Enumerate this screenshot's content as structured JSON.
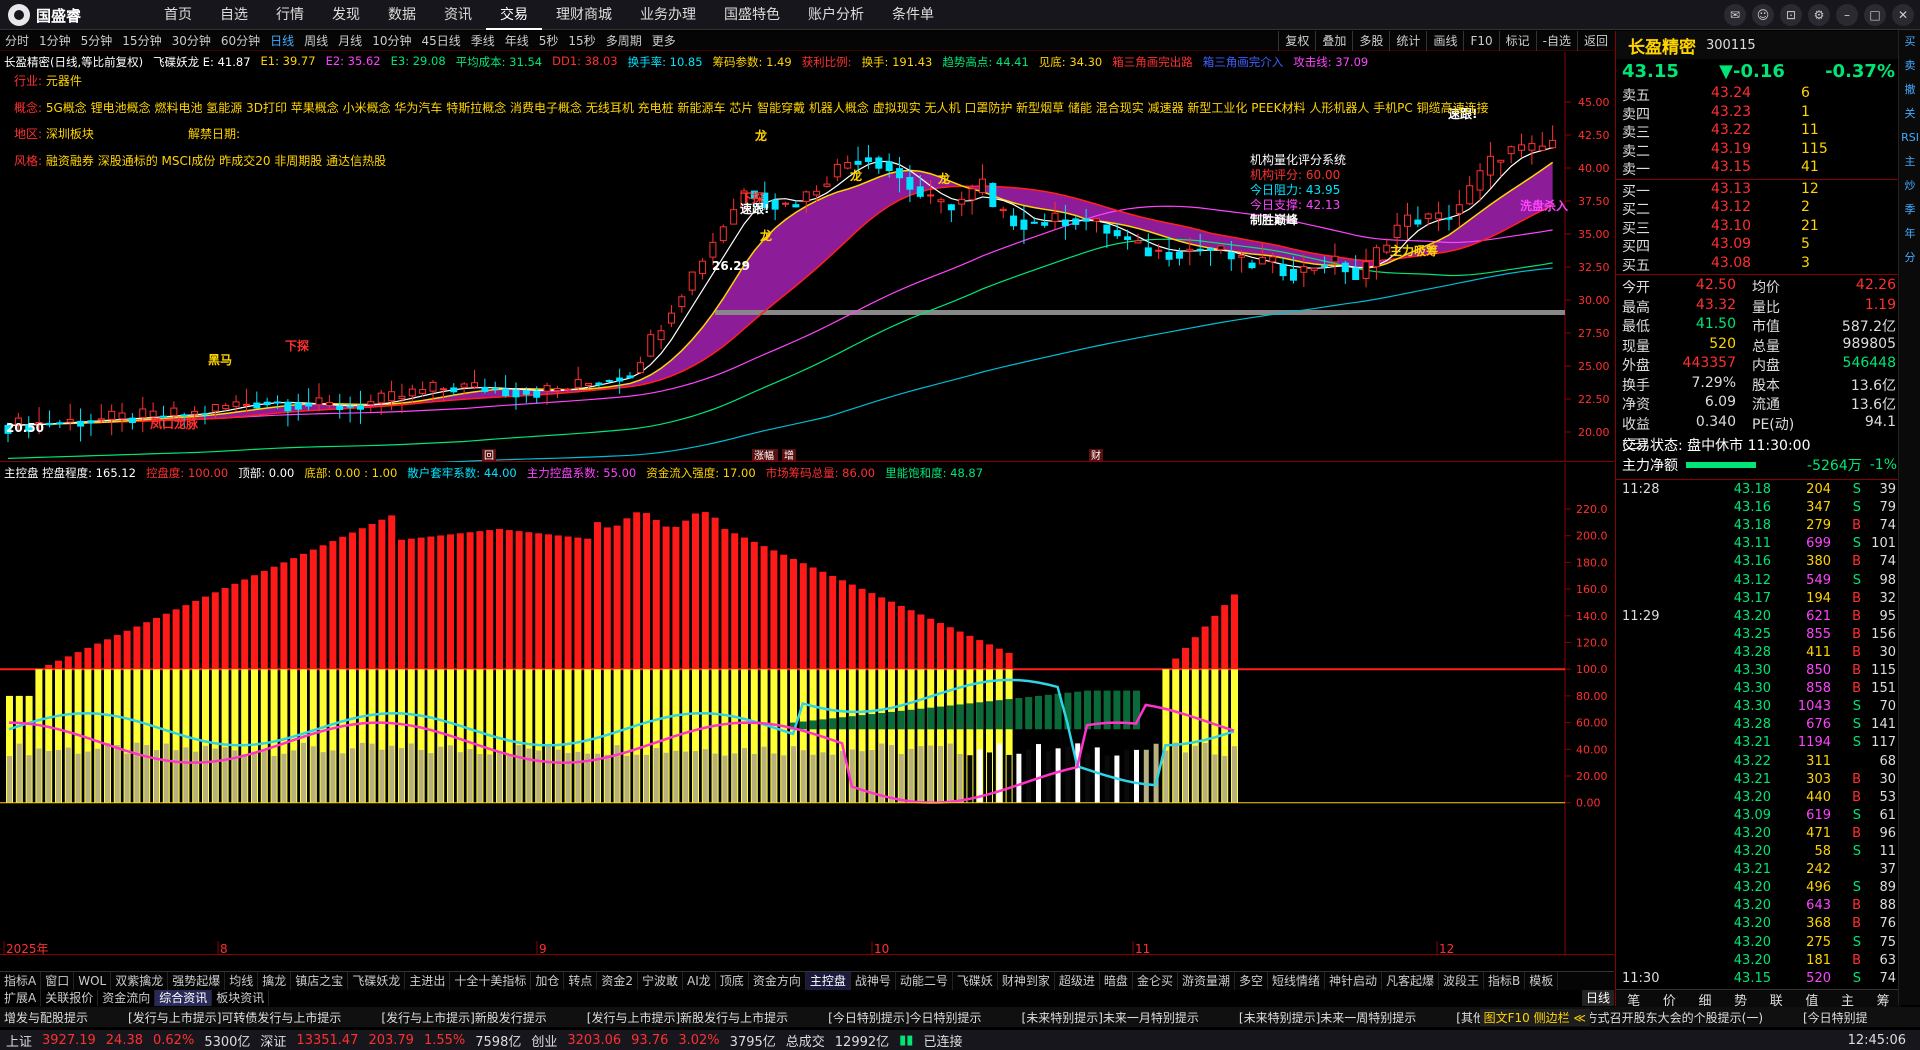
{
  "app": {
    "title": "国盛睿"
  },
  "menu": [
    "首页",
    "自选",
    "行情",
    "发现",
    "数据",
    "资讯",
    "交易",
    "理财商城",
    "业务办理",
    "国盛特色",
    "账户分析",
    "条件单"
  ],
  "menu_active": 6,
  "periods": [
    "分时",
    "1分钟",
    "5分钟",
    "15分钟",
    "30分钟",
    "60分钟",
    "日线",
    "周线",
    "月线",
    "10分钟",
    "45日线",
    "季线",
    "年线",
    "5秒",
    "15秒",
    "多周期",
    "更多"
  ],
  "period_active": 6,
  "right_tools": [
    "复权",
    "叠加",
    "多股",
    "统计",
    "画线",
    "F10",
    "标记",
    "-自选",
    "返回"
  ],
  "legend_main": [
    {
      "t": "长盈精密(日线,等比前复权)",
      "c": "#ffffff"
    },
    {
      "t": "飞碟妖龙 E: 41.87",
      "c": "#ffffff"
    },
    {
      "t": "E1: 39.77",
      "c": "#ffd400"
    },
    {
      "t": "E2: 35.62",
      "c": "#ff44ff"
    },
    {
      "t": "E3: 29.08",
      "c": "#00e676"
    },
    {
      "t": "平均成本: 31.54",
      "c": "#00e676"
    },
    {
      "t": "DD1: 38.03",
      "c": "#ff3030"
    },
    {
      "t": "换手率: 10.85",
      "c": "#00e5ff"
    },
    {
      "t": "筹码参数: 1.49",
      "c": "#ffd400"
    },
    {
      "t": "获利比例:",
      "c": "#ff3030"
    },
    {
      "t": "换手: 191.43",
      "c": "#ffd400"
    },
    {
      "t": "趋势高点: 44.41",
      "c": "#00e676"
    },
    {
      "t": "见底: 34.30",
      "c": "#ffd400"
    },
    {
      "t": "箱三角画完出路",
      "c": "#ff3030"
    },
    {
      "t": "箱三角画完介入",
      "c": "#4060ff"
    },
    {
      "t": "攻击线: 37.09",
      "c": "#ff44ff"
    }
  ],
  "info": {
    "industry_label": "行业:",
    "industry": "元器件",
    "concept_label": "概念:",
    "concepts": "5G概念 锂电池概念 燃料电池 氢能源 3D打印 苹果概念 小米概念 华为汽车 特斯拉概念 消费电子概念 无线耳机 充电桩 新能源车 芯片 智能穿戴 机器人概念 虚拟现实 无人机 口罩防护 新型烟草 储能 混合现实 减速器 新型工业化 PEEK材料 人形机器人 手机PC 铜缆高速连接",
    "region_label": "地区:",
    "region": "深圳板块",
    "lift_label": "解禁日期:",
    "style_label": "风格:",
    "style": "融资融券 深股通标的 MSCI成份 昨成交20 非周期股 通达信热股"
  },
  "score": {
    "title": "机构量化评分系统",
    "score_label": "机构评分: 60.00",
    "res_label": "今日阻力: 43.95",
    "sup_label": "今日支撑: 42.13",
    "win": "制胜巅峰"
  },
  "main_annotations": [
    "龙",
    "龙",
    "龙",
    "龙",
    "速跟!",
    "速跟!",
    "黑马",
    "下探",
    "下探",
    "主力吸筹",
    "洗盘杀入",
    "凤口龙脉",
    "26.29",
    "20.50"
  ],
  "price_axis": [
    "45.00",
    "42.50",
    "40.00",
    "37.50",
    "35.00",
    "32.50",
    "30.00",
    "27.50",
    "25.00",
    "22.50",
    "20.00"
  ],
  "sub_axis": [
    "220.0",
    "200.0",
    "180.0",
    "160.0",
    "140.0",
    "120.0",
    "100.0",
    "80.00",
    "60.00",
    "40.00",
    "20.00",
    "0.00"
  ],
  "date_axis": [
    "2025年",
    "8",
    "9",
    "10",
    "11",
    "12"
  ],
  "event_markers": [
    "回",
    "涨幅",
    "增",
    "财"
  ],
  "legend_sub": [
    {
      "t": "主控盘 控盘程度: 165.12",
      "c": "#ffffff"
    },
    {
      "t": "控盘度: 100.00",
      "c": "#ff3030"
    },
    {
      "t": "顶部: 0.00",
      "c": "#ffffff"
    },
    {
      "t": "底部: 0.00 : 1.00",
      "c": "#ffd400"
    },
    {
      "t": "散户套牢系数: 44.00",
      "c": "#00e5ff"
    },
    {
      "t": "主力控盘系数: 55.00",
      "c": "#ff44ff"
    },
    {
      "t": "资金流入强度: 17.00",
      "c": "#ffd400"
    },
    {
      "t": "市场筹码总量: 86.00",
      "c": "#ff3030"
    },
    {
      "t": "里能饱和度: 48.87",
      "c": "#00e676"
    }
  ],
  "quote": {
    "name": "长盈精密",
    "code": "300115",
    "price": "43.15",
    "change": "▼-0.16",
    "pct": "-0.37%",
    "asks": [
      {
        "l": "卖五",
        "p": "43.24",
        "v": "6"
      },
      {
        "l": "卖四",
        "p": "43.23",
        "v": "1"
      },
      {
        "l": "卖三",
        "p": "43.22",
        "v": "11"
      },
      {
        "l": "卖二",
        "p": "43.19",
        "v": "115"
      },
      {
        "l": "卖一",
        "p": "43.15",
        "v": "41"
      }
    ],
    "bids": [
      {
        "l": "买一",
        "p": "43.13",
        "v": "12"
      },
      {
        "l": "买二",
        "p": "43.12",
        "v": "2"
      },
      {
        "l": "买三",
        "p": "43.10",
        "v": "21"
      },
      {
        "l": "买四",
        "p": "43.09",
        "v": "5"
      },
      {
        "l": "买五",
        "p": "43.08",
        "v": "3"
      }
    ],
    "stats": [
      {
        "k1": "今开",
        "v1": "42.50",
        "c1": "#ff3030",
        "k2": "均价",
        "v2": "42.26",
        "c2": "#ff3030"
      },
      {
        "k1": "最高",
        "v1": "43.32",
        "c1": "#ff3030",
        "k2": "量比",
        "v2": "1.19",
        "c2": "#ff3030"
      },
      {
        "k1": "最低",
        "v1": "41.50",
        "c1": "#00e676",
        "k2": "市值",
        "v2": "587.2亿",
        "c2": "#dddddd"
      },
      {
        "k1": "现量",
        "v1": "520",
        "c1": "#ffd400",
        "k2": "总量",
        "v2": "989805",
        "c2": "#dddddd"
      },
      {
        "k1": "外盘",
        "v1": "443357",
        "c1": "#ff3030",
        "k2": "内盘",
        "v2": "546448",
        "c2": "#00e676"
      },
      {
        "k1": "换手",
        "v1": "7.29%",
        "c1": "#dddddd",
        "k2": "股本",
        "v2": "13.6亿",
        "c2": "#dddddd"
      },
      {
        "k1": "净资",
        "v1": "6.09",
        "c1": "#dddddd",
        "k2": "流通",
        "v2": "13.6亿",
        "c2": "#dddddd"
      },
      {
        "k1": "收益(三)",
        "v1": "0.340",
        "c1": "#dddddd",
        "k2": "PE(动)",
        "v2": "94.1",
        "c2": "#dddddd"
      }
    ],
    "trade_status": "交易状态: 盘中休市 11:30:00",
    "netflow_label": "主力净额",
    "netflow_val": "-5264万",
    "netflow_pct": "-1%",
    "ticks": [
      {
        "t": "11:28",
        "p": "43.18",
        "v": "204",
        "b": "S",
        "n": "39"
      },
      {
        "t": "",
        "p": "43.16",
        "v": "347",
        "b": "S",
        "n": "79"
      },
      {
        "t": "",
        "p": "43.18",
        "v": "279",
        "b": "B",
        "n": "74"
      },
      {
        "t": "",
        "p": "43.11",
        "v": "699",
        "b": "S",
        "n": "101"
      },
      {
        "t": "",
        "p": "43.16",
        "v": "380",
        "b": "B",
        "n": "74"
      },
      {
        "t": "",
        "p": "43.12",
        "v": "549",
        "b": "S",
        "n": "98"
      },
      {
        "t": "",
        "p": "43.17",
        "v": "194",
        "b": "B",
        "n": "32"
      },
      {
        "t": "11:29",
        "p": "43.20",
        "v": "621",
        "b": "B",
        "n": "95"
      },
      {
        "t": "",
        "p": "43.25",
        "v": "855",
        "b": "B",
        "n": "156"
      },
      {
        "t": "",
        "p": "43.28",
        "v": "411",
        "b": "B",
        "n": "30"
      },
      {
        "t": "",
        "p": "43.30",
        "v": "850",
        "b": "B",
        "n": "115"
      },
      {
        "t": "",
        "p": "43.30",
        "v": "858",
        "b": "B",
        "n": "151"
      },
      {
        "t": "",
        "p": "43.30",
        "v": "1043",
        "b": "S",
        "n": "70"
      },
      {
        "t": "",
        "p": "43.28",
        "v": "676",
        "b": "S",
        "n": "141"
      },
      {
        "t": "",
        "p": "43.21",
        "v": "1194",
        "b": "S",
        "n": "117"
      },
      {
        "t": "",
        "p": "43.22",
        "v": "311",
        "b": "",
        "n": "68"
      },
      {
        "t": "",
        "p": "43.21",
        "v": "303",
        "b": "B",
        "n": "30"
      },
      {
        "t": "",
        "p": "43.20",
        "v": "440",
        "b": "B",
        "n": "53"
      },
      {
        "t": "",
        "p": "43.09",
        "v": "619",
        "b": "S",
        "n": "61"
      },
      {
        "t": "",
        "p": "43.20",
        "v": "471",
        "b": "B",
        "n": "96"
      },
      {
        "t": "",
        "p": "43.20",
        "v": "58",
        "b": "S",
        "n": "11"
      },
      {
        "t": "",
        "p": "43.21",
        "v": "242",
        "b": "",
        "n": "37"
      },
      {
        "t": "",
        "p": "43.20",
        "v": "496",
        "b": "S",
        "n": "89"
      },
      {
        "t": "",
        "p": "43.20",
        "v": "643",
        "b": "B",
        "n": "88"
      },
      {
        "t": "",
        "p": "43.20",
        "v": "368",
        "b": "B",
        "n": "76"
      },
      {
        "t": "",
        "p": "43.20",
        "v": "275",
        "b": "S",
        "n": "75"
      },
      {
        "t": "",
        "p": "43.20",
        "v": "181",
        "b": "B",
        "n": "63"
      },
      {
        "t": "11:30",
        "p": "43.15",
        "v": "520",
        "b": "S",
        "n": "74"
      }
    ],
    "bottom_tabs": [
      "笔",
      "价",
      "细",
      "势",
      "联",
      "值",
      "主",
      "筹"
    ]
  },
  "side_icons": [
    "买",
    "卖",
    "撤",
    "关",
    "RSI",
    "主",
    "炒",
    "季",
    "年",
    "分"
  ],
  "tabs": [
    "指标A",
    "窗口",
    "WOL",
    "双紫擒龙",
    "强势起爆",
    "均线",
    "擒龙",
    "镇店之宝",
    "飞碟妖龙",
    "主进出",
    "十全十美指标",
    "加仓",
    "转点",
    "资金2",
    "宁波敢",
    "AI龙",
    "顶底",
    "资金方向",
    "主控盘",
    "战神号",
    "动能二号",
    "飞碟妖",
    "财神到家",
    "超级进",
    "暗盘",
    "金仑买",
    "游资量潮",
    "多空",
    "短线情绪",
    "神针启动",
    "凡客起爆",
    "波段王",
    "指标B",
    "模板"
  ],
  "tabs_active": 18,
  "tabs2": [
    "扩展A",
    "关联报价",
    "资金流向",
    "综合资讯",
    "板块资讯"
  ],
  "tabs2_active": 3,
  "side_label": "日线",
  "news": [
    "增发与配股提示",
    "[发行与上市提示]可转债发行与上市提示",
    "[发行与上市提示]新股发行提示",
    "[发行与上市提示]新股发行与上市提示",
    "[今日特别提示]今日特别提示",
    "[未来特别提示]未来一月特别提示",
    "[未来特别提示]未来一周特别提示",
    "[其他提示]以现场和网络方式召开股东大会的个股提示(一)",
    "[今日特别提"
  ],
  "news_right": "图文F10 侧边栏 ≪",
  "status": {
    "sh_label": "上证",
    "sh": "3927.19",
    "sh_chg": "24.38",
    "sh_pct": "0.62%",
    "sh_amt": "5300亿",
    "sz_label": "深证",
    "sz": "13351.47",
    "sz_chg": "203.79",
    "sz_pct": "1.55%",
    "sz_amt": "7598亿",
    "cy_label": "创业",
    "cy": "3203.06",
    "cy_chg": "93.76",
    "cy_pct": "3.02%",
    "cy_amt": "3795亿",
    "total_label": "总成交",
    "total": "12992亿",
    "conn": "已连接",
    "time": "12:45:06"
  },
  "colors": {
    "up": "#ff3030",
    "down": "#00e676",
    "yellow": "#ffd400",
    "cyan": "#00e5ff",
    "magenta": "#ff44ff",
    "accent": "#4aa8ff"
  }
}
